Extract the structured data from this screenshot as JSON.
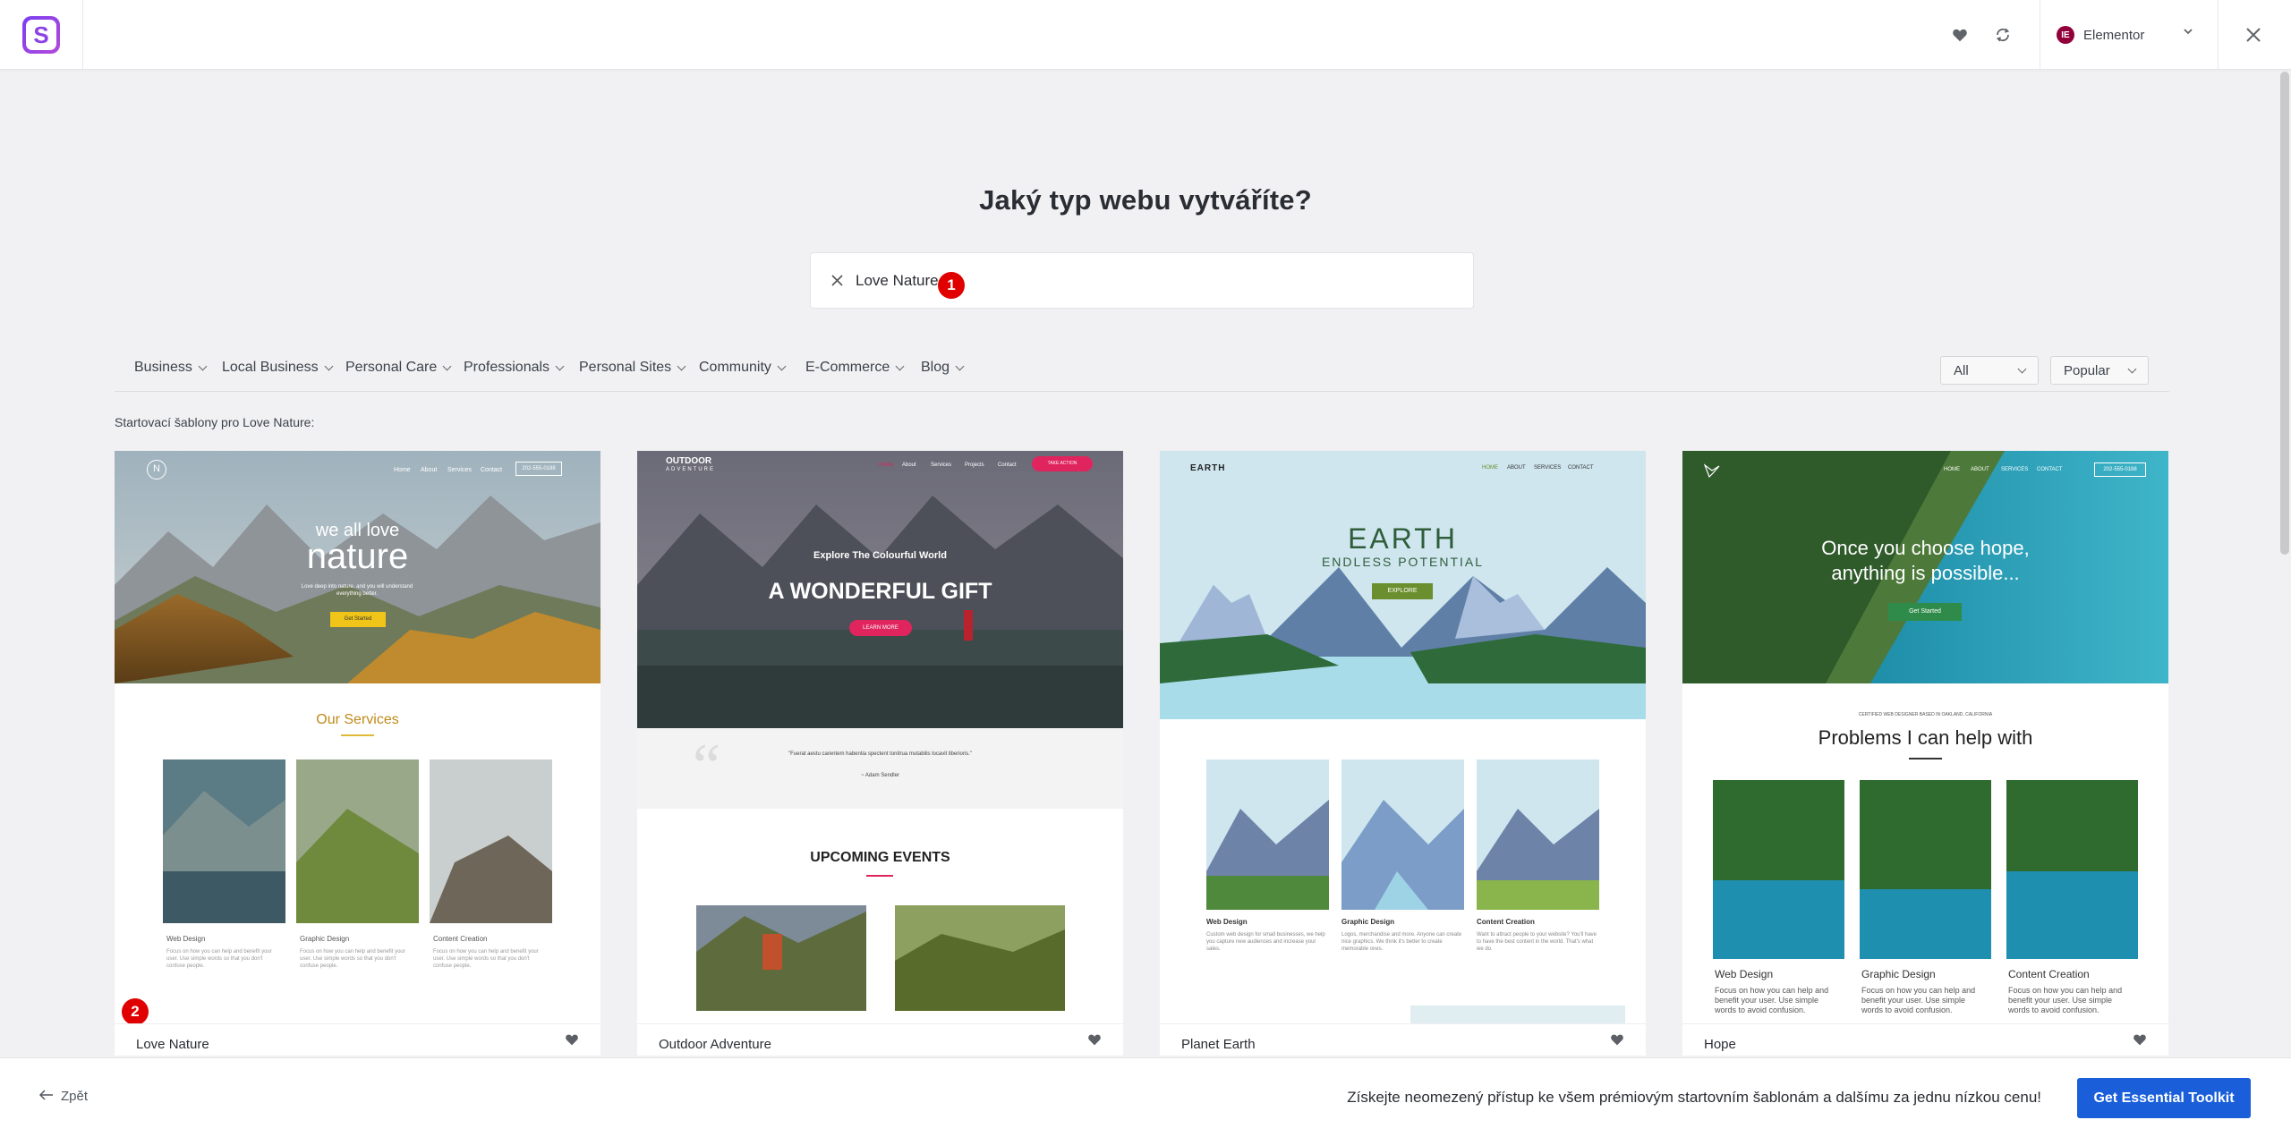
{
  "topbar": {
    "logo_letter": "S",
    "icons": [
      "heart-icon",
      "refresh-icon",
      "chevron-down-icon",
      "close-icon"
    ],
    "builder": {
      "badge": "IE",
      "label": "Elementor"
    }
  },
  "main": {
    "heading": "Jaký typ webu vytváříte?",
    "search": {
      "value": "Love Nature",
      "marker": "1"
    },
    "categories": [
      "Business",
      "Local Business",
      "Personal Care",
      "Professionals",
      "Personal Sites",
      "Community",
      "E-Commerce",
      "Blog"
    ],
    "filter_type": "All",
    "sort": "Popular",
    "results_label": "Startovací šablony pro Love Nature:"
  },
  "cards": [
    {
      "title": "Love Nature",
      "marker": "2",
      "preview": {
        "nav": [
          "Home",
          "About",
          "Services",
          "Contact"
        ],
        "phone": "202-555-0188",
        "hero_small": "we all love",
        "hero_big": "nature",
        "hero_sub": "Love deep into nature, and you will understand everything better.",
        "button": "Get Started",
        "section": "Our Services",
        "services": [
          "Web Design",
          "Graphic Design",
          "Content Creation"
        ],
        "service_text": "Focus on how you can help and benefit your user. Use simple words so that you don't confuse people."
      }
    },
    {
      "title": "Outdoor Adventure",
      "preview": {
        "brand": "OUTDOOR",
        "brand_sub": "ADVENTURE",
        "nav": [
          "Home",
          "About",
          "Services",
          "Projects",
          "Contact"
        ],
        "nav_button": "TAKE ACTION",
        "kicker": "Explore The Colourful World",
        "headline": "A WONDERFUL GIFT",
        "button": "LEARN MORE",
        "quote": "\"Fuerat aestu carentem habentia spectent tonitrua mutabilis locavit liberioris.\"",
        "quote_author": "~ Adam Sendler",
        "section": "UPCOMING EVENTS"
      }
    },
    {
      "title": "Planet Earth",
      "preview": {
        "brand": "EARTH",
        "nav": [
          "HOME",
          "ABOUT",
          "SERVICES",
          "CONTACT"
        ],
        "headline": "EARTH",
        "subline": "ENDLESS POTENTIAL",
        "button": "EXPLORE",
        "services": [
          "Web Design",
          "Graphic Design",
          "Content Creation"
        ],
        "service_texts": [
          "Custom web design for small businesses, we help you capture new audiences and increase your sales.",
          "Logos, merchandise and more. Anyone can create nice graphics. We think it's better to create memorable ones.",
          "Want to attract people to your website? You'll have to have the best content in the world. That's what we do."
        ]
      }
    },
    {
      "title": "Hope",
      "preview": {
        "nav": [
          "HOME",
          "ABOUT",
          "SERVICES",
          "CONTACT"
        ],
        "phone": "202-555-0188",
        "headline_1": "Once you choose hope,",
        "headline_2": "anything is possible...",
        "button": "Get Started",
        "kicker": "CERTIFIED WEB DESIGNER BASED IN OAKLAND, CALIFORNIA",
        "section": "Problems I can help with",
        "services": [
          "Web Design",
          "Graphic Design",
          "Content Creation"
        ],
        "service_text": "Focus on how you can help and benefit your user. Use simple words to avoid confusion."
      }
    }
  ],
  "bottombar": {
    "back": "Zpět",
    "promo": "Získejte neomezený přístup ke všem prémiovým startovním šablonám a dalšímu za jednu nízkou cenu!",
    "cta": "Get Essential Toolkit"
  },
  "colors": {
    "accent": "#1a5fd9",
    "brand_purple": "#8c43e6",
    "marker_red": "#e00000",
    "elementor": "#92003b"
  }
}
